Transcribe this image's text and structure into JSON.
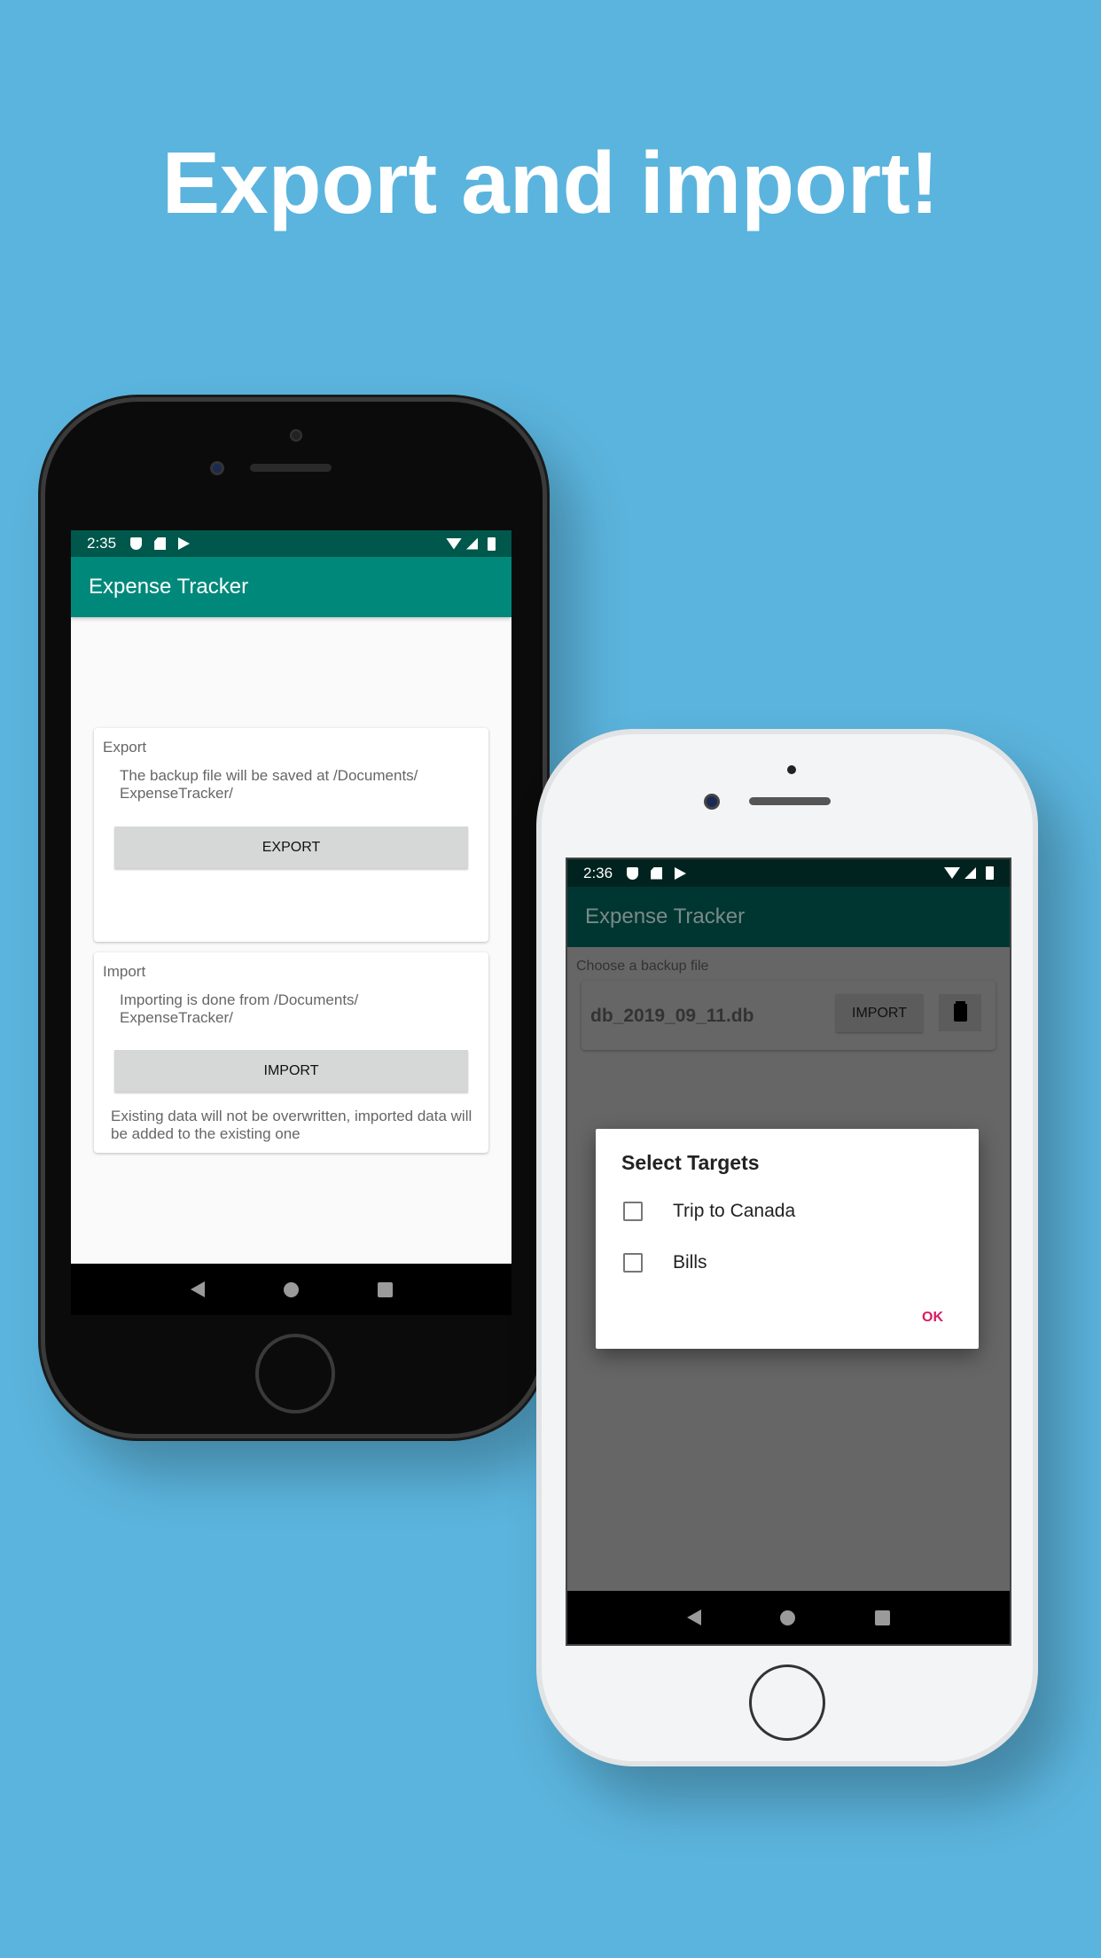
{
  "headline": "Export and import!",
  "colors": {
    "background": "#5bb4dd",
    "app_bar": "#00897b",
    "status_bar": "#00574b",
    "dialog_accent": "#d81b60"
  },
  "phone1": {
    "status": {
      "time": "2:35",
      "left_icons": [
        "shield-icon",
        "sd-card-icon",
        "play-store-icon"
      ],
      "right_icons": [
        "wifi-icon",
        "signal-icon",
        "battery-icon"
      ]
    },
    "app_title": "Expense Tracker",
    "export_card": {
      "title": "Export",
      "description": "The backup file will be saved at /Documents/ ExpenseTracker/",
      "button": "EXPORT"
    },
    "import_card": {
      "title": "Import",
      "description": "Importing is done from /Documents/ ExpenseTracker/",
      "button": "IMPORT",
      "note": "Existing data will not be overwritten, imported data will be added to the existing one"
    }
  },
  "phone2": {
    "status": {
      "time": "2:36"
    },
    "app_title": "Expense Tracker",
    "section_label": "Choose a backup file",
    "file": {
      "name": "db_2019_09_11.db",
      "import_button": "IMPORT"
    },
    "dialog": {
      "title": "Select Targets",
      "options": [
        {
          "label": "Trip to Canada",
          "checked": false
        },
        {
          "label": "Bills",
          "checked": false
        }
      ],
      "ok": "OK"
    }
  }
}
